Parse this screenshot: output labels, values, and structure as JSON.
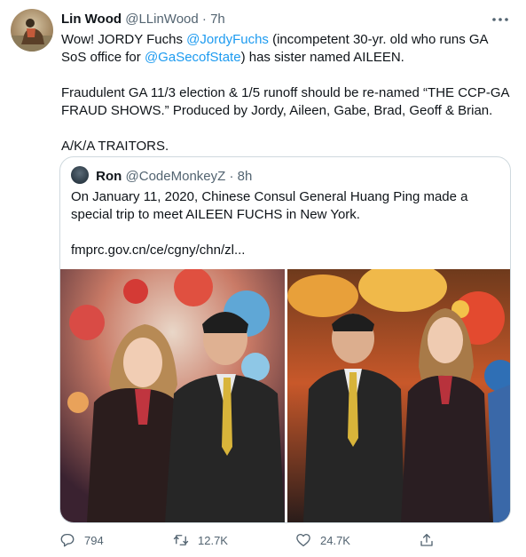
{
  "tweet": {
    "display_name": "Lin Wood",
    "handle": "@LLinWood",
    "dot": "·",
    "time": "7h",
    "avatar_icon": "user-avatar",
    "more_icon": "more-horizontal-icon",
    "body": {
      "line1_pre": "Wow! JORDY Fuchs ",
      "mention1": "@JordyFuchs",
      "line1_post": " (incompetent 30-yr. old who runs GA SoS office for ",
      "mention2": "@GaSecofState",
      "line1_end": ") has sister named AILEEN.",
      "para2": "Fraudulent GA 11/3 election & 1/5 runoff should be re-named “THE CCP-GA FRAUD SHOWS.” Produced by Jordy, Aileen, Gabe, Brad, Geoff & Brian.",
      "para3": "A/K/A TRAITORS."
    }
  },
  "quote": {
    "display_name": "Ron",
    "handle": "@CodeMonkeyZ",
    "dot": "·",
    "time": "8h",
    "text": "On January 11, 2020, Chinese Consul General Huang Ping made a special trip to meet AILEEN FUCHS in New York.",
    "link": "fmprc.gov.cn/ce/cgny/chn/zl..."
  },
  "actions": {
    "reply_count": "794",
    "retweet_count": "12.7K",
    "like_count": "24.7K"
  },
  "colors": {
    "accent": "#1d9bf0",
    "text": "#0f1419",
    "secondary": "#536471",
    "border": "#cfd9de"
  },
  "icons": {
    "reply": "reply-icon",
    "retweet": "retweet-icon",
    "like": "heart-icon",
    "share": "share-icon"
  }
}
